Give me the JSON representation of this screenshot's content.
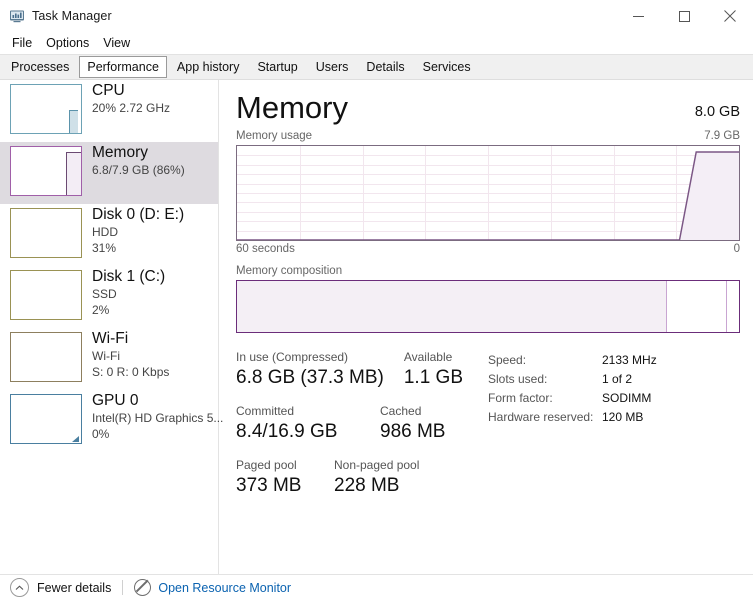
{
  "window": {
    "title": "Task Manager",
    "icon": "task-manager-icon",
    "controls": {
      "minimize": "minimize-icon",
      "maximize": "maximize-icon",
      "close": "close-icon"
    }
  },
  "menu": {
    "items": [
      "File",
      "Options",
      "View"
    ]
  },
  "tabs": {
    "items": [
      {
        "label": "Processes",
        "selected": false
      },
      {
        "label": "Performance",
        "selected": true
      },
      {
        "label": "App history",
        "selected": false
      },
      {
        "label": "Startup",
        "selected": false
      },
      {
        "label": "Users",
        "selected": false
      },
      {
        "label": "Details",
        "selected": false
      },
      {
        "label": "Services",
        "selected": false
      }
    ]
  },
  "sidebar": {
    "items": [
      {
        "name": "cpu",
        "title": "CPU",
        "sub1": "20%  2.72 GHz",
        "sub2": "",
        "selected": false,
        "accent": "#6da2b5"
      },
      {
        "name": "memory",
        "title": "Memory",
        "sub1": "6.8/7.9 GB (86%)",
        "sub2": "",
        "selected": true,
        "accent": "#a05fa8"
      },
      {
        "name": "disk-0",
        "title": "Disk 0 (D: E:)",
        "sub1": "HDD",
        "sub2": "31%",
        "selected": false,
        "accent": "#9a9254"
      },
      {
        "name": "disk-1",
        "title": "Disk 1 (C:)",
        "sub1": "SSD",
        "sub2": "2%",
        "selected": false,
        "accent": "#9a9254"
      },
      {
        "name": "wifi",
        "title": "Wi-Fi",
        "sub1": "Wi-Fi",
        "sub2": "S: 0 R: 0 Kbps",
        "selected": false,
        "accent": "#8d7f5e"
      },
      {
        "name": "gpu-0",
        "title": "GPU 0",
        "sub1": "Intel(R) HD Graphics 5...",
        "sub2": "0%",
        "selected": false,
        "accent": "#4a7fa0"
      }
    ]
  },
  "main": {
    "title": "Memory",
    "total": "8.0 GB",
    "usage_caption_left": "Memory usage",
    "usage_caption_right": "7.9 GB",
    "axis_left": "60 seconds",
    "axis_right": "0",
    "composition_caption": "Memory composition",
    "stats": {
      "in_use_label": "In use (Compressed)",
      "in_use_value": "6.8 GB (37.3 MB)",
      "available_label": "Available",
      "available_value": "1.1 GB",
      "committed_label": "Committed",
      "committed_value": "8.4/16.9 GB",
      "cached_label": "Cached",
      "cached_value": "986 MB",
      "paged_pool_label": "Paged pool",
      "paged_pool_value": "373 MB",
      "non_paged_pool_label": "Non-paged pool",
      "non_paged_pool_value": "228 MB"
    },
    "specs": [
      {
        "key": "Speed:",
        "value": "2133 MHz"
      },
      {
        "key": "Slots used:",
        "value": "1 of 2"
      },
      {
        "key": "Form factor:",
        "value": "SODIMM"
      },
      {
        "key": "Hardware reserved:",
        "value": "120 MB"
      }
    ]
  },
  "chart_data": {
    "type": "area",
    "title": "Memory usage",
    "xlabel": "",
    "ylabel": "",
    "ylim": [
      0,
      7.9
    ],
    "xlim": [
      60,
      0
    ],
    "x_tick_labels": [
      "60 seconds",
      "0"
    ],
    "y_max_label": "7.9 GB",
    "grid": true,
    "series": [
      {
        "name": "Memory in use (GB)",
        "points": [
          {
            "t": 60,
            "v": 0.0
          },
          {
            "t": 12,
            "v": 0.0
          },
          {
            "t": 9.5,
            "v": 0.0
          },
          {
            "t": 7.5,
            "v": 6.8
          },
          {
            "t": 0,
            "v": 6.8
          }
        ]
      }
    ],
    "composition": {
      "type": "bar",
      "orientation": "horizontal",
      "segments": [
        {
          "name": "In use",
          "fraction": 0.855
        },
        {
          "name": "Available",
          "fraction": 0.145
        }
      ],
      "markers": [
        0.855,
        0.975
      ]
    }
  },
  "statusbar": {
    "fewer_details": "Fewer details",
    "open_resource_monitor": "Open Resource Monitor"
  }
}
